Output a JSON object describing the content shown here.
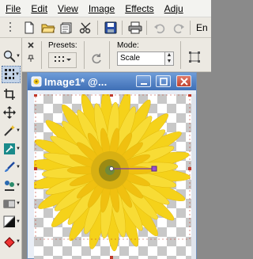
{
  "menu": {
    "items": [
      {
        "label": "File"
      },
      {
        "label": "Edit"
      },
      {
        "label": "View"
      },
      {
        "label": "Image"
      },
      {
        "label": "Effects"
      },
      {
        "label": "Adju"
      }
    ]
  },
  "toolbar": {
    "overflow_text": "En"
  },
  "tool_options": {
    "presets_label": "Presets:",
    "mode_label": "Mode:",
    "mode_value": "Scale"
  },
  "image_window": {
    "title": "Image1* @..."
  },
  "colors": {
    "title_bar": "#4a7cc2",
    "pick_handle": "#9a4fd0",
    "selection_handle": "#c0392b",
    "flower_petal": "#f5d21a",
    "flower_center": "#9a8a14"
  }
}
